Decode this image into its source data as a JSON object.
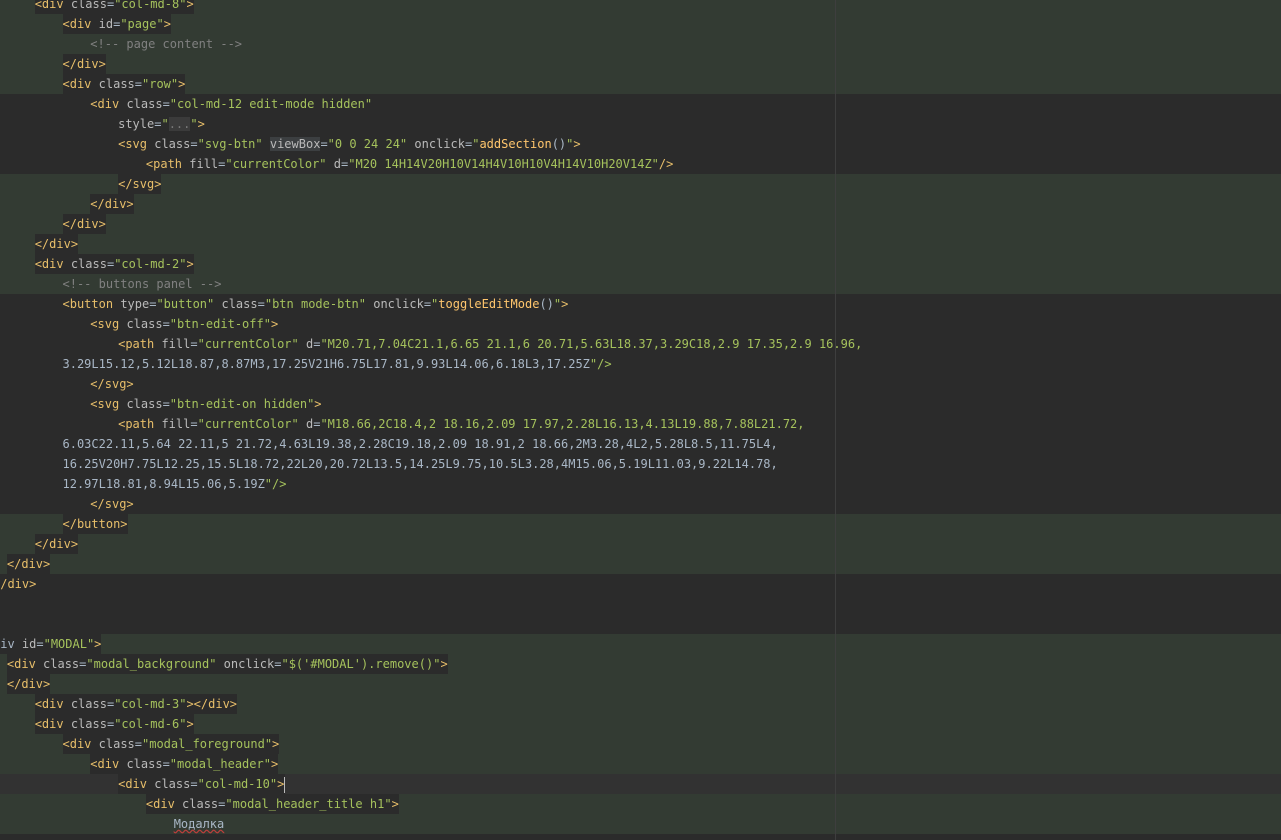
{
  "editor": {
    "language": "HTML",
    "cursor_line": "<div class=\"col-md-10\">",
    "modal_text": "Модалка",
    "lines": [
      {
        "indent": 6,
        "text": "<div class=\"col-md-8\">"
      },
      {
        "indent": 10,
        "text": "<div id=\"page\">"
      },
      {
        "indent": 14,
        "text": "<!-- page content -->"
      },
      {
        "indent": 10,
        "text": "</div>"
      },
      {
        "indent": 10,
        "text": "<div class=\"row\">"
      },
      {
        "indent": 14,
        "text": "<div class=\"col-md-12 edit-mode hidden\""
      },
      {
        "indent": 18,
        "text": "style=\"...\">"
      },
      {
        "indent": 18,
        "text": "<svg class=\"svg-btn\" viewBox=\"0 0 24 24\" onclick=\"addSection()\">"
      },
      {
        "indent": 22,
        "text": "<path fill=\"currentColor\" d=\"M20 14H14V20H10V14H4V10H10V4H14V10H20V14Z\"/>"
      },
      {
        "indent": 18,
        "text": "</svg>"
      },
      {
        "indent": 14,
        "text": "</div>"
      },
      {
        "indent": 10,
        "text": "</div>"
      },
      {
        "indent": 6,
        "text": "</div>"
      },
      {
        "indent": 6,
        "text": "<div class=\"col-md-2\">"
      },
      {
        "indent": 10,
        "text": "<!-- buttons panel -->"
      },
      {
        "indent": 10,
        "text": "<button type=\"button\" class=\"btn mode-btn\" onclick=\"toggleEditMode()\">"
      },
      {
        "indent": 14,
        "text": "<svg class=\"btn-edit-off\">"
      },
      {
        "indent": 18,
        "text": "<path fill=\"currentColor\" d=\"M20.71,7.04C21.1,6.65 21.1,6 20.71,5.63L18.37,3.29C18,2.9 17.35,2.9 16.96,"
      },
      {
        "indent": 10,
        "text": "3.29L15.12,5.12L18.87,8.87M3,17.25V21H6.75L17.81,9.93L14.06,6.18L3,17.25Z\"/>"
      },
      {
        "indent": 14,
        "text": "</svg>"
      },
      {
        "indent": 14,
        "text": "<svg class=\"btn-edit-on hidden\">"
      },
      {
        "indent": 18,
        "text": "<path fill=\"currentColor\" d=\"M18.66,2C18.4,2 18.16,2.09 17.97,2.28L16.13,4.13L19.88,7.88L21.72,"
      },
      {
        "indent": 10,
        "text": "6.03C22.11,5.64 22.11,5 21.72,4.63L19.38,2.28C19.18,2.09 18.91,2 18.66,2M3.28,4L2,5.28L8.5,11.75L4,"
      },
      {
        "indent": 10,
        "text": "16.25V20H7.75L12.25,15.5L18.72,22L20,20.72L13.5,14.25L9.75,10.5L3.28,4M15.06,5.19L11.03,9.22L14.78,"
      },
      {
        "indent": 10,
        "text": "12.97L18.81,8.94L15.06,5.19Z\"/>"
      },
      {
        "indent": 14,
        "text": "</svg>"
      },
      {
        "indent": 10,
        "text": "</button>"
      },
      {
        "indent": 6,
        "text": "</div>"
      },
      {
        "indent": 2,
        "text": "</div>"
      },
      {
        "indent": 0,
        "text": "</div>"
      },
      {
        "indent": 0,
        "text": ""
      },
      {
        "indent": 0,
        "text": ""
      },
      {
        "indent": 0,
        "text": "div id=\"MODAL\">"
      },
      {
        "indent": 2,
        "text": "<div class=\"modal_background\" onclick=\"$('#MODAL').remove()\">"
      },
      {
        "indent": 2,
        "text": "</div>"
      },
      {
        "indent": 6,
        "text": "<div class=\"col-md-3\"></div>"
      },
      {
        "indent": 6,
        "text": "<div class=\"col-md-6\">"
      },
      {
        "indent": 10,
        "text": "<div class=\"modal_foreground\">"
      },
      {
        "indent": 14,
        "text": "<div class=\"modal_header\">"
      },
      {
        "indent": 18,
        "text": "<div class=\"col-md-10\">"
      },
      {
        "indent": 22,
        "text": "<div class=\"modal_header_title h1\">"
      },
      {
        "indent": 26,
        "text": "Модалка"
      }
    ]
  }
}
